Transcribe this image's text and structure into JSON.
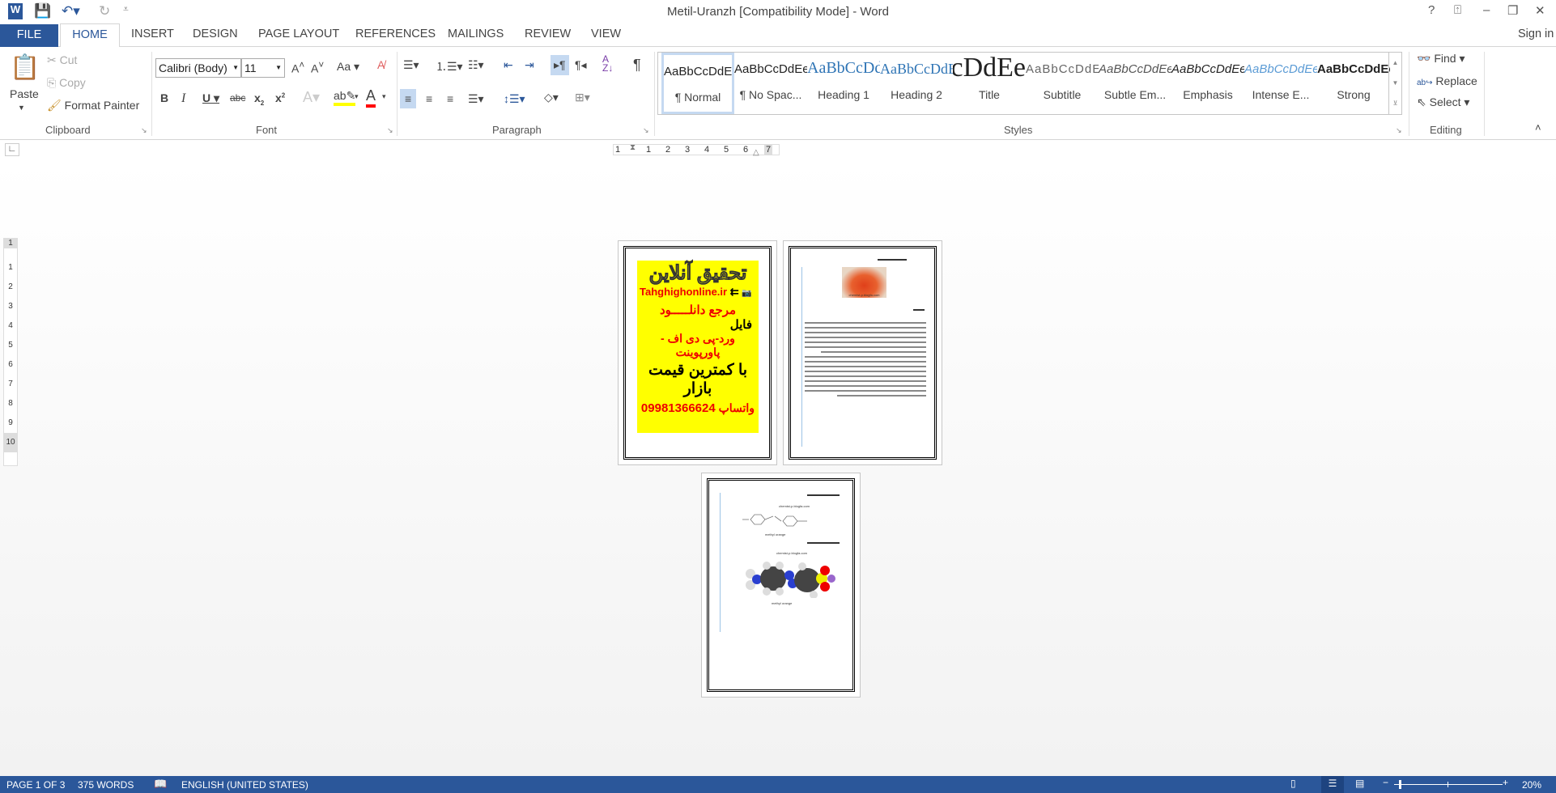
{
  "window": {
    "title": "Metil-Uranzh [Compatibility Mode] - Word",
    "help": "?",
    "sign_in": "Sign in"
  },
  "tabs": [
    "FILE",
    "HOME",
    "INSERT",
    "DESIGN",
    "PAGE LAYOUT",
    "REFERENCES",
    "MAILINGS",
    "REVIEW",
    "VIEW"
  ],
  "clipboard": {
    "paste": "Paste",
    "cut": "Cut",
    "copy": "Copy",
    "format_painter": "Format Painter",
    "label": "Clipboard"
  },
  "font": {
    "name": "Calibri (Body)",
    "size": "11",
    "change_case": "Aa",
    "label": "Font",
    "highlight_color": "#ffff00",
    "font_color": "#ff0000"
  },
  "paragraph": {
    "label": "Paragraph"
  },
  "styles": {
    "label": "Styles",
    "items": [
      {
        "preview": "AaBbCcDdEe",
        "name": "¶ Normal"
      },
      {
        "preview": "AaBbCcDdEe",
        "name": "¶ No Spac..."
      },
      {
        "preview": "AaBbCcDdEe",
        "name": "Heading 1"
      },
      {
        "preview": "AaBbCcDdEe",
        "name": "Heading 2"
      },
      {
        "preview": "AaBbCcDdEe",
        "name": "Title"
      },
      {
        "preview": "AaBbCcDdEe",
        "name": "Subtitle"
      },
      {
        "preview": "AaBbCcDdEe",
        "name": "Subtle Em..."
      },
      {
        "preview": "AaBbCcDdEe",
        "name": "Emphasis"
      },
      {
        "preview": "AaBbCcDdEe",
        "name": "Intense E..."
      },
      {
        "preview": "AaBbCcDdEe",
        "name": "Strong"
      }
    ]
  },
  "editing": {
    "find": "Find",
    "replace": "Replace",
    "select": "Select",
    "label": "Editing"
  },
  "ruler": {
    "h": [
      "1",
      "1",
      "2",
      "3",
      "4",
      "5",
      "6",
      "7"
    ],
    "v": [
      "1",
      "1",
      "2",
      "3",
      "4",
      "5",
      "6",
      "7",
      "8",
      "9",
      "10"
    ]
  },
  "pages": {
    "p1": {
      "title": "تحقیق آنلاین",
      "site": "Tahghighonline.ir",
      "l1": "مرجع دانلـــــود",
      "l2": "فایل",
      "l3": "ورد-پی دی اف - پاورپوینت",
      "l4": "با کمترین قیمت بازار",
      "phone": "09981366624",
      "whatsapp": "واتساپ"
    },
    "p2": {
      "caption": "chemist-p.blogfa.com"
    },
    "p3": {
      "caption_site": "chemist-p.blogfa.com",
      "caption1": "methyl orange",
      "caption2": "methyl orange"
    }
  },
  "status": {
    "page": "PAGE 1 OF 3",
    "words": "375 WORDS",
    "language": "ENGLISH (UNITED STATES)",
    "zoom": "20%",
    "zoom_level_percent": 20,
    "accent": "#2b579a"
  }
}
